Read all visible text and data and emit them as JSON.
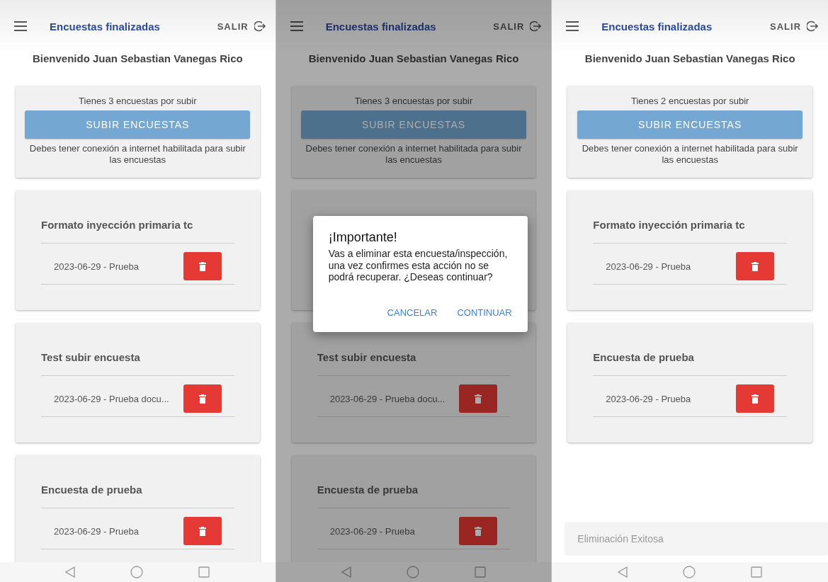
{
  "screens": [
    {
      "header": {
        "title": "Encuestas finalizadas",
        "logout": "SALIR"
      },
      "welcome": "Bienvenido Juan Sebastian Vanegas Rico",
      "upload": {
        "count_text": "Tienes 3 encuestas por subir",
        "button": "SUBIR ENCUESTAS",
        "note": "Debes tener conexión a internet habilitada para subir las encuestas"
      },
      "surveys": [
        {
          "title": "Formato inyección primaria tc",
          "entries": [
            {
              "text": "2023-06-29 - Prueba"
            }
          ]
        },
        {
          "title": "Test subir encuesta",
          "entries": [
            {
              "text": "2023-06-29 - Prueba docu..."
            }
          ]
        },
        {
          "title": "Encuesta de prueba",
          "entries": [
            {
              "text": "2023-06-29 - Prueba"
            }
          ]
        }
      ]
    },
    {
      "header": {
        "title": "Encuestas finalizadas",
        "logout": "SALIR"
      },
      "welcome": "Bienvenido Juan Sebastian Vanegas Rico",
      "upload": {
        "count_text": "Tienes 3 encuestas por subir",
        "button": "SUBIR ENCUESTAS",
        "note": "Debes tener conexión a internet habilitada para subir las encuestas"
      },
      "surveys": [
        {
          "hidden_by_dialog": true
        },
        {
          "title": "Test subir encuesta",
          "entries": [
            {
              "text": "2023-06-29 - Prueba docu..."
            }
          ]
        },
        {
          "title": "Encuesta de prueba",
          "entries": [
            {
              "text": "2023-06-29 - Prueba"
            }
          ]
        }
      ],
      "dialog": {
        "title": "¡Importante!",
        "message": "Vas a eliminar esta encuesta/inspección, una vez confirmes esta acción no se podrá recuperar. ¿Deseas continuar?",
        "buttons": [
          "CANCELAR",
          "CONTINUAR"
        ]
      }
    },
    {
      "header": {
        "title": "Encuestas finalizadas",
        "logout": "SALIR"
      },
      "welcome": "Bienvenido Juan Sebastian Vanegas Rico",
      "upload": {
        "count_text": "Tienes 2 encuestas por subir",
        "button": "SUBIR ENCUESTAS",
        "note": "Debes tener conexión a internet habilitada para subir las encuestas"
      },
      "surveys": [
        {
          "title": "Formato inyección primaria tc",
          "entries": [
            {
              "text": "2023-06-29 - Prueba"
            }
          ]
        },
        {
          "title": "Encuesta de prueba",
          "entries": [
            {
              "text": "2023-06-29 - Prueba"
            }
          ]
        }
      ],
      "toast": "Eliminación Exitosa"
    }
  ]
}
